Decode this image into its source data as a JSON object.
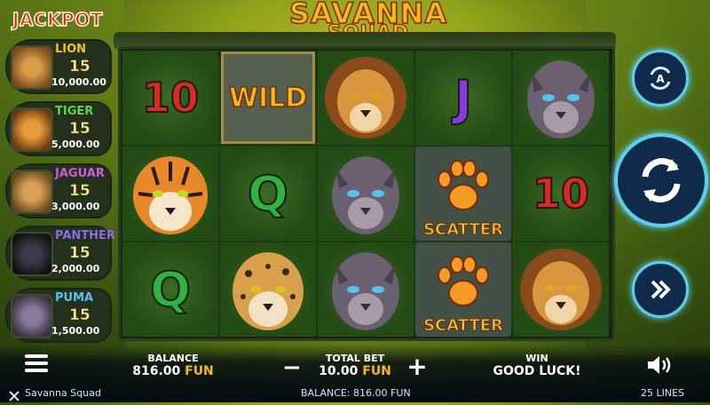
{
  "logo": {
    "line1": "SAVANNA",
    "line2": "SQUAD"
  },
  "jackpot": {
    "title": "JACKPOT",
    "items": [
      {
        "name": "LION",
        "count": "15",
        "amount": "10,000.00",
        "color": "#f7c028",
        "portrait": "lion-portrait-icon"
      },
      {
        "name": "TIGER",
        "count": "15",
        "amount": "5,000.00",
        "color": "#5fd34a",
        "portrait": "tiger-portrait-icon"
      },
      {
        "name": "JAGUAR",
        "count": "15",
        "amount": "3,000.00",
        "color": "#d05ad8",
        "portrait": "jaguar-portrait-icon"
      },
      {
        "name": "PANTHER",
        "count": "15",
        "amount": "2,000.00",
        "color": "#8a6ae8",
        "portrait": "panther-portrait-icon"
      },
      {
        "name": "PUMA",
        "count": "15",
        "amount": "1,500.00",
        "color": "#5ac0f0",
        "portrait": "puma-portrait-icon"
      }
    ]
  },
  "reels": {
    "r1": [
      "10",
      "tiger",
      "Q"
    ],
    "r2": [
      "WILD",
      "Q",
      "jaguar"
    ],
    "r3": [
      "lion",
      "puma",
      "puma"
    ],
    "r4": [
      "J",
      "SCATTER",
      "SCATTER"
    ],
    "r5": [
      "puma",
      "10",
      "lion"
    ]
  },
  "symbols": {
    "ten": "10",
    "wild": "WILD",
    "j": "J",
    "q": "Q",
    "scatter": "SCATTER"
  },
  "bottom": {
    "balance_label": "BALANCE",
    "balance_amount": "816.00",
    "currency": "FUN",
    "bet_label": "TOTAL BET",
    "bet_amount": "10.00",
    "win_label": "WIN",
    "win_value": "GOOD LUCK!",
    "minus": "−",
    "plus": "+"
  },
  "footer": {
    "game_name": "Savanna Squad",
    "balance_text": "BALANCE: 816.00 FUN",
    "lines": "25 LINES"
  },
  "colors": {
    "accent": "#5ad0f0",
    "gold": "#f7b814",
    "red_jackpot": "#d42a1d"
  }
}
